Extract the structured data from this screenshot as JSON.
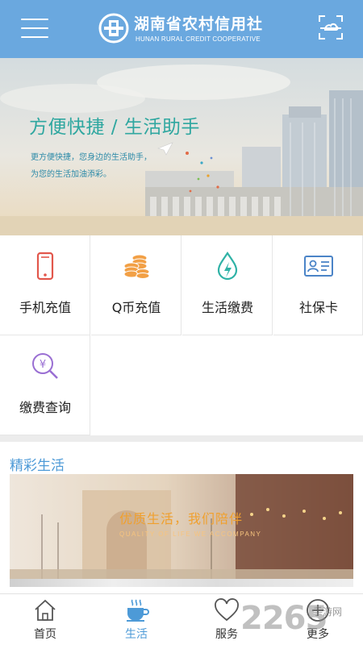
{
  "header": {
    "brand_cn": "湖南省农村信用社",
    "brand_en": "HUNAN RURAL CREDIT COOPERATIVE",
    "menu_icon": "hamburger-menu-icon",
    "scan_icon": "scan-icon",
    "color": "#6aa8df"
  },
  "banner": {
    "title": "方便快捷 / 生活助手",
    "subtitle_line1": "更方便快捷，您身边的生活助手，",
    "subtitle_line2": "为您的生活加油添彩。",
    "title_color": "#2fa7a0"
  },
  "services": [
    {
      "label": "手机充值",
      "icon": "mobile-phone-icon"
    },
    {
      "label": "Q币充值",
      "icon": "coins-icon"
    },
    {
      "label": "生活缴费",
      "icon": "utility-drop-icon"
    },
    {
      "label": "社保卡",
      "icon": "id-card-icon"
    },
    {
      "label": "缴费查询",
      "icon": "yuan-search-icon"
    }
  ],
  "section": {
    "title": "精彩生活",
    "promo_title": "优质生活，我们陪伴",
    "promo_en": "QUALITY OF LIFE WE ACCOMPANY",
    "accent": "#4d9ad7"
  },
  "tabs": [
    {
      "label": "首页",
      "icon": "home-icon"
    },
    {
      "label": "生活",
      "icon": "coffee-cup-icon",
      "active": true
    },
    {
      "label": "服务",
      "icon": "heart-icon"
    },
    {
      "label": "更多",
      "icon": "plus-circle-icon"
    }
  ],
  "watermark": {
    "number": "2265",
    "text": "手游网"
  }
}
